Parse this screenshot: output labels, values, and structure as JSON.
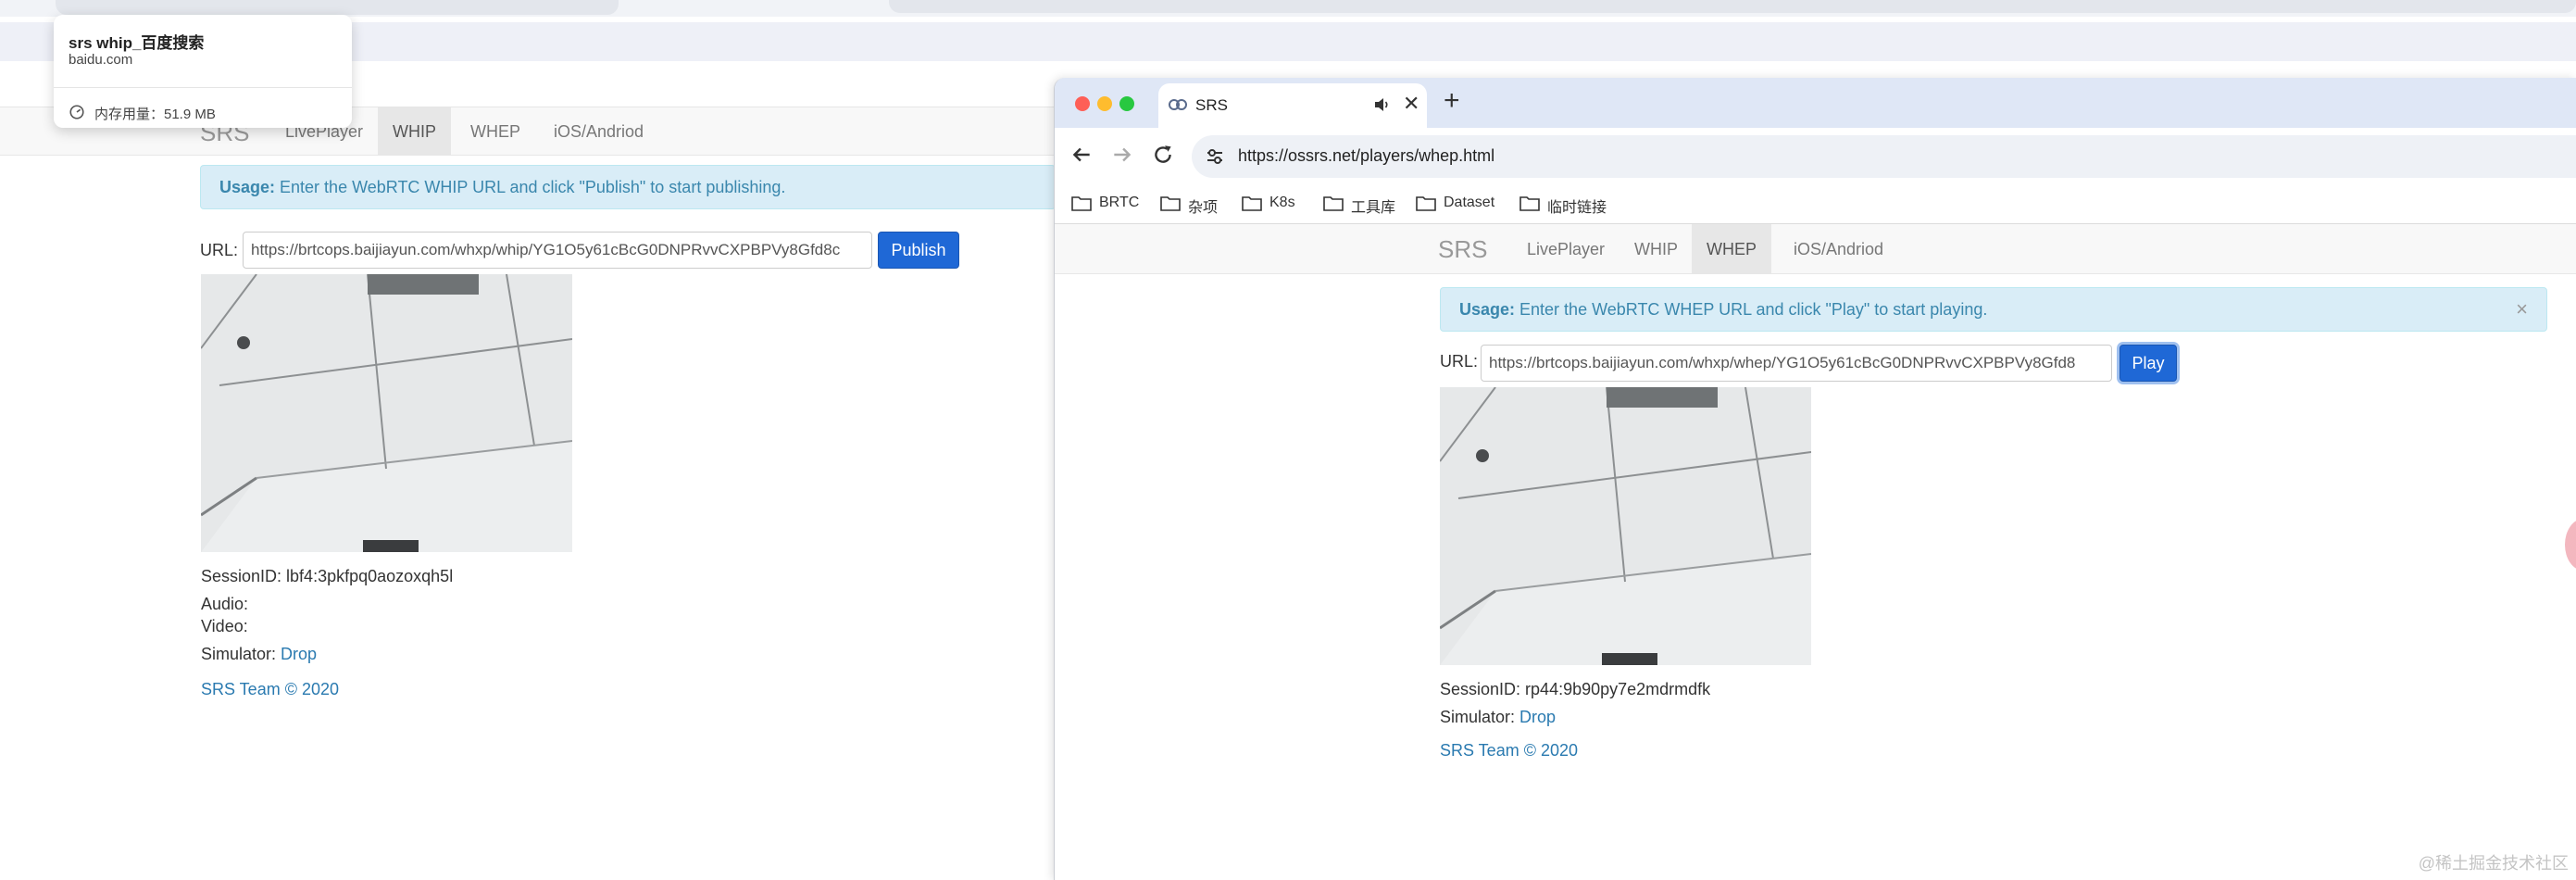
{
  "background_browser": {
    "nav": {
      "brand": "SRS",
      "links": [
        "LivePlayer",
        "WHIP",
        "WHEP",
        "iOS/Andriod"
      ],
      "active": "WHIP"
    },
    "alert": {
      "bold": "Usage:",
      "text": " Enter the WebRTC WHIP URL and click \"Publish\" to start publishing."
    },
    "url_label": "URL:",
    "url_value": "https://brtcops.baijiayun.com/whxp/whip/YG1O5y61cBcG0DNPRvvCXPBPVy8Gfd8c",
    "publish_label": "Publish",
    "session_label": "SessionID: ",
    "session_id": "lbf4:3pkfpq0aozoxqh5l",
    "audio_label": "Audio:",
    "video_label": "Video:",
    "simulator_label": "Simulator: ",
    "drop_link": "Drop",
    "footer": "SRS Team © 2020"
  },
  "hover_card": {
    "title": "srs whip_百度搜索",
    "site": "baidu.com",
    "memory": "内存用量：51.9 MB"
  },
  "foreground_browser": {
    "tab_title": "SRS",
    "address": "https://ossrs.net/players/whep.html",
    "bookmarks": [
      "BRTC",
      "杂项",
      "K8s",
      "工具库",
      "Dataset",
      "临时链接"
    ],
    "nav": {
      "brand": "SRS",
      "links": [
        "LivePlayer",
        "WHIP",
        "WHEP",
        "iOS/Andriod"
      ],
      "active": "WHEP"
    },
    "alert": {
      "bold": "Usage:",
      "text": " Enter the WebRTC WHEP URL and click \"Play\" to start playing.",
      "close": "×"
    },
    "url_label": "URL:",
    "url_value": "https://brtcops.baijiayun.com/whxp/whep/YG1O5y61cBcG0DNPRvvCXPBPVy8Gfd8",
    "play_label": "Play",
    "session_label": "SessionID: ",
    "session_id": "rp44:9b90py7e2mdrmdfk",
    "simulator_label": "Simulator: ",
    "drop_link": "Drop",
    "footer": "SRS Team © 2020"
  },
  "watermark": "@稀土掘金技术社区",
  "colors": {
    "accent": "#1f68d6",
    "alert_bg": "#d9edf7",
    "link": "#2a7ab0"
  }
}
